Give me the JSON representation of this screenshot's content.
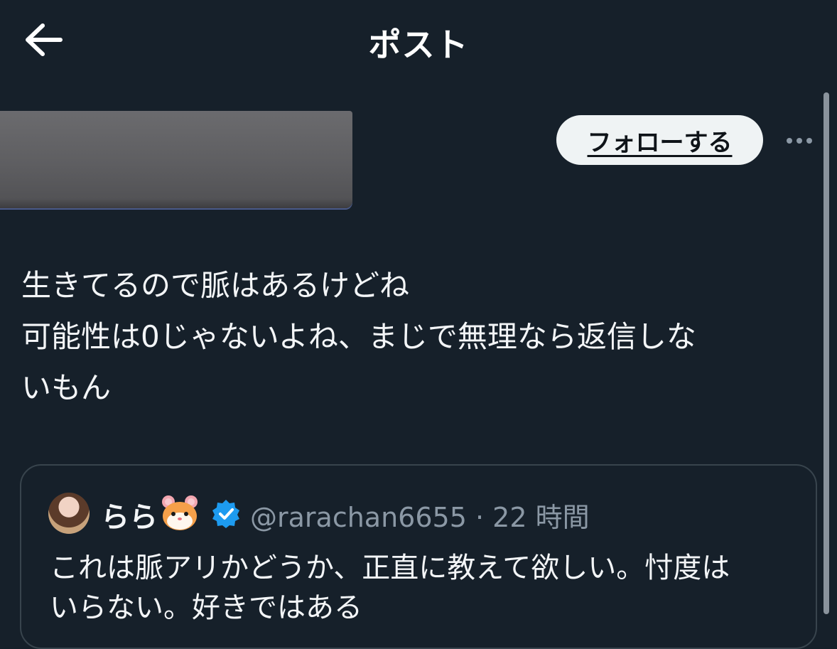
{
  "header": {
    "title": "ポスト",
    "back_icon": "arrow-left-icon"
  },
  "follow_button": {
    "label": "フォローする"
  },
  "more_icon": "more-horizontal-icon",
  "post": {
    "lines": [
      "生きてるので脈はあるけどね",
      "可能性は0じゃないよね、まじで無理なら返信しな",
      "いもん"
    ]
  },
  "quoted": {
    "display_name": "らら",
    "emoji_icon": "hamster-face-icon",
    "verified_icon": "verified-badge-icon",
    "handle": "@rarachan6655",
    "separator": "·",
    "time": "22 時間",
    "lines": [
      "これは脈アリかどうか、正直に教えて欲しい。忖度は",
      "いらない。好きではある"
    ]
  },
  "colors": {
    "background": "#16202a",
    "text": "#f3f5f7",
    "muted": "#8b98a5",
    "border": "#38444d",
    "verified": "#1d9bf0",
    "follow_bg": "#eff3f4"
  }
}
